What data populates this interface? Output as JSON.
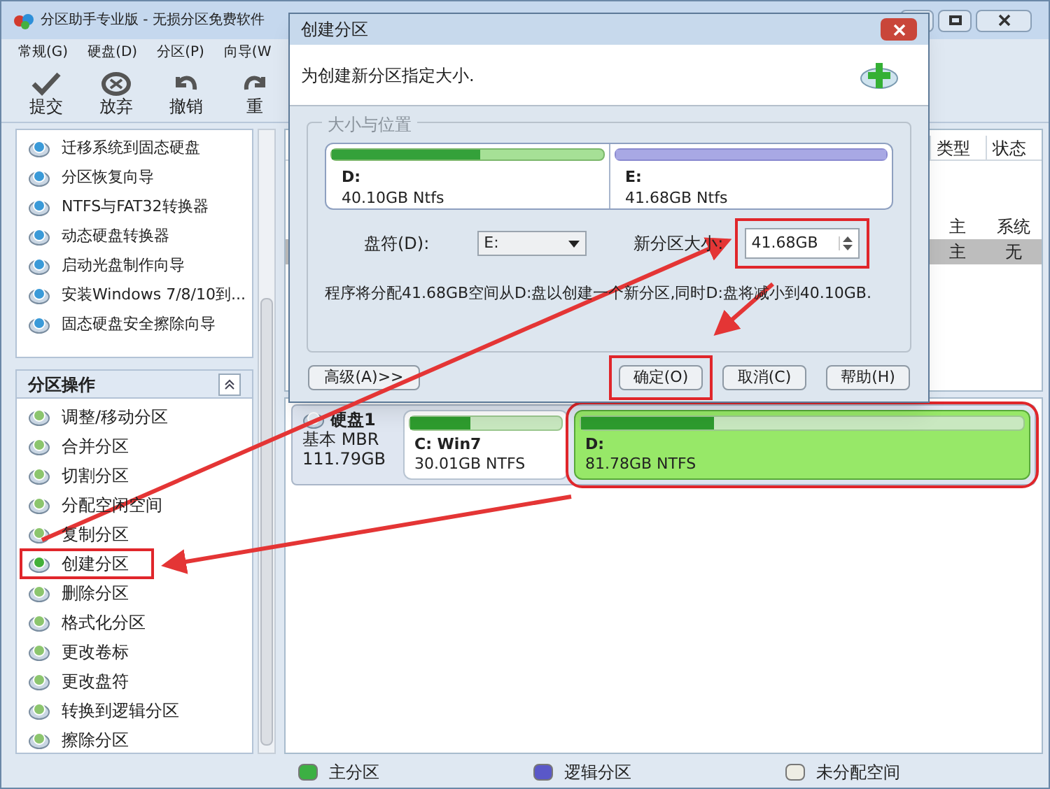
{
  "app": {
    "title": "分区助手专业版 - 无损分区免费软件"
  },
  "menu": [
    "常规(G)",
    "硬盘(D)",
    "分区(P)",
    "向导(W"
  ],
  "toolbar": [
    {
      "label": "提交",
      "kind": "check"
    },
    {
      "label": "放弃",
      "kind": "discard"
    },
    {
      "label": "撤销",
      "kind": "undo"
    },
    {
      "label": "重",
      "kind": "redo"
    }
  ],
  "wizards": [
    "迁移系统到固态硬盘",
    "分区恢复向导",
    "NTFS与FAT32转换器",
    "动态硬盘转换器",
    "启动光盘制作向导",
    "安装Windows 7/8/10到...",
    "固态硬盘安全擦除向导"
  ],
  "operations": {
    "title": "分区操作",
    "items": [
      {
        "label": "调整/移动分区",
        "highlighted": false
      },
      {
        "label": "合并分区",
        "highlighted": false
      },
      {
        "label": "切割分区",
        "highlighted": false
      },
      {
        "label": "分配空闲空间",
        "highlighted": false
      },
      {
        "label": "复制分区",
        "highlighted": false
      },
      {
        "label": "创建分区",
        "highlighted": true
      },
      {
        "label": "删除分区",
        "highlighted": false
      },
      {
        "label": "格式化分区",
        "highlighted": false
      },
      {
        "label": "更改卷标",
        "highlighted": false
      },
      {
        "label": "更改盘符",
        "highlighted": false
      },
      {
        "label": "转换到逻辑分区",
        "highlighted": false
      },
      {
        "label": "擦除分区",
        "highlighted": false
      }
    ]
  },
  "table": {
    "columns": [
      "类型",
      "状态"
    ],
    "rows": [
      {
        "cells": [
          "主",
          "系统"
        ],
        "selected": false
      },
      {
        "cells": [
          "主",
          "无"
        ],
        "selected": true
      }
    ]
  },
  "disk": {
    "name": "硬盘1",
    "type": "基本 MBR",
    "size": "111.79GB",
    "partitions": [
      {
        "name": "C: Win7",
        "detail": "30.01GB NTFS",
        "level": 0.4,
        "selected": false,
        "highlighted": false
      },
      {
        "name": "D:",
        "detail": "81.78GB NTFS",
        "level": 0.3,
        "selected": true,
        "highlighted": true
      }
    ]
  },
  "legend": [
    {
      "label": "主分区",
      "color": "#3cb043"
    },
    {
      "label": "逻辑分区",
      "color": "#5a58c8"
    },
    {
      "label": "未分配空间",
      "color": "#eeede4"
    }
  ],
  "dialog": {
    "title": "创建分区",
    "heading": "为创建新分区指定大小.",
    "group": "大小与位置",
    "partitions": [
      {
        "name": "D:",
        "detail": "40.10GB Ntfs",
        "kind": "primary",
        "level": 0.55
      },
      {
        "name": "E:",
        "detail": "41.68GB Ntfs",
        "kind": "new",
        "level": 1
      }
    ],
    "drive_label": "盘符(D):",
    "drive_value": "E:",
    "size_label": "新分区大小:",
    "size_value": "41.68GB",
    "size_highlighted": true,
    "message": "程序将分配41.68GB空间从D:盘以创建一个新分区,同时D:盘将减小到40.10GB.",
    "buttons": [
      {
        "label": "高级(A)>>",
        "highlighted": false
      },
      {
        "label": "确定(O)",
        "highlighted": true
      },
      {
        "label": "取消(C)",
        "highlighted": false
      },
      {
        "label": "帮助(H)",
        "highlighted": false
      }
    ]
  }
}
